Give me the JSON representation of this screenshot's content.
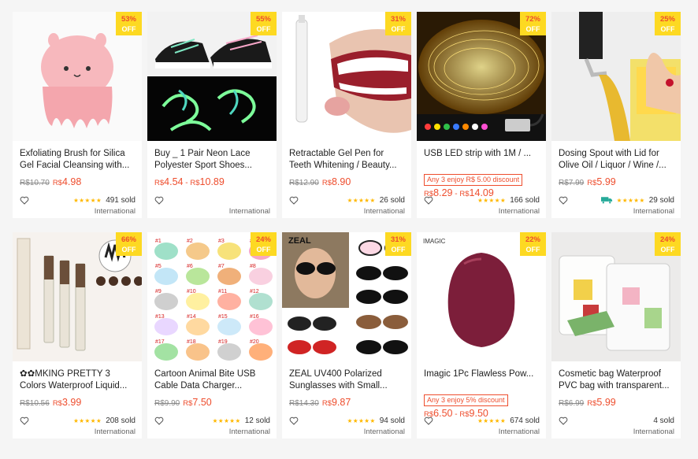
{
  "products": [
    {
      "discount": "53%",
      "off": "OFF",
      "title": "Exfoliating Brush for Silica Gel Facial Cleansing with...",
      "promo": "",
      "orig_price": "R$10.70",
      "price_label": "R$",
      "price": "4.98",
      "price_max_label": "",
      "price_max": "",
      "stars": "★★★★★",
      "sold": "491 sold",
      "ship": "International",
      "icon": "heart-icon"
    },
    {
      "discount": "55%",
      "off": "OFF",
      "title": "Buy _ 1 Pair Neon Lace Polyester Sport Shoes...",
      "promo": "",
      "orig_price": "",
      "price_label": "R$",
      "price": "4.54",
      "price_max_label": "R$",
      "price_max": "10.89",
      "stars": "",
      "sold": "",
      "ship": "International",
      "icon": "heart-icon"
    },
    {
      "discount": "31%",
      "off": "OFF",
      "title": "Retractable Gel Pen for Teeth Whitening / Beauty...",
      "promo": "",
      "orig_price": "R$12.90",
      "price_label": "R$",
      "price": "8.90",
      "price_max_label": "",
      "price_max": "",
      "stars": "★★★★★",
      "sold": "26 sold",
      "ship": "International",
      "icon": "heart-icon"
    },
    {
      "discount": "72%",
      "off": "OFF",
      "title": "USB LED strip with 1M / ...",
      "promo": "Any 3 enjoy R$ 5.00 discount",
      "orig_price": "",
      "price_label": "R$",
      "price": "8.29",
      "price_max_label": "R$",
      "price_max": "14.09",
      "stars": "★★★★★",
      "sold": "166 sold",
      "ship": "International",
      "icon": "heart-icon"
    },
    {
      "discount": "25%",
      "off": "OFF",
      "title": "Dosing Spout with Lid for Olive Oil / Liquor / Wine /...",
      "promo": "",
      "orig_price": "R$7.99",
      "price_label": "R$",
      "price": "5.99",
      "price_max_label": "",
      "price_max": "",
      "stars": "★★★★★",
      "sold": "29 sold",
      "ship": "International",
      "icon": "heart-icon",
      "truck": true
    },
    {
      "discount": "66%",
      "off": "OFF",
      "title": "✿✿MKING PRETTY 3 Colors Waterproof Liquid...",
      "promo": "",
      "orig_price": "R$10.56",
      "price_label": "R$",
      "price": "3.99",
      "price_max_label": "",
      "price_max": "",
      "stars": "★★★★★",
      "sold": "208 sold",
      "ship": "International",
      "icon": "heart-icon"
    },
    {
      "discount": "24%",
      "off": "OFF",
      "title": "Cartoon Animal Bite USB Cable Data Charger...",
      "promo": "",
      "orig_price": "R$9.90",
      "price_label": "R$",
      "price": "7.50",
      "price_max_label": "",
      "price_max": "",
      "stars": "★★★★★",
      "sold": "12 sold",
      "ship": "International",
      "icon": "heart-icon"
    },
    {
      "discount": "31%",
      "off": "OFF",
      "title": "ZEAL UV400 Polarized Sunglasses with Small...",
      "promo": "",
      "orig_price": "R$14.30",
      "price_label": "R$",
      "price": "9.87",
      "price_max_label": "",
      "price_max": "",
      "stars": "★★★★★",
      "sold": "94 sold",
      "ship": "International",
      "icon": "heart-icon"
    },
    {
      "discount": "22%",
      "off": "OFF",
      "title": "Imagic 1Pc Flawless Pow...",
      "promo": "Any 3 enjoy 5% discount",
      "orig_price": "",
      "price_label": "R$",
      "price": "6.50",
      "price_max_label": "R$",
      "price_max": "9.50",
      "stars": "★★★★★",
      "sold": "674 sold",
      "ship": "International",
      "icon": "heart-icon"
    },
    {
      "discount": "24%",
      "off": "OFF",
      "title": "Cosmetic bag Waterproof PVC bag with transparent...",
      "promo": "",
      "orig_price": "R$6.99",
      "price_label": "R$",
      "price": "5.99",
      "price_max_label": "",
      "price_max": "",
      "stars": "",
      "sold": "4 sold",
      "ship": "International",
      "icon": "heart-icon"
    }
  ],
  "image_texts": {
    "zeal_logo": "ZEAL",
    "imagic_logo": "IMAGIC",
    "cable_labels": [
      "#1",
      "#2",
      "#3",
      "#4",
      "#5",
      "#6",
      "#7",
      "#8",
      "#9",
      "#10",
      "#11",
      "#12",
      "#13",
      "#14",
      "#15",
      "#16",
      "#17",
      "#18",
      "#19",
      "#20"
    ]
  },
  "colors": {
    "accent": "#ee4d2d",
    "badge": "#fdd922",
    "stars": "#ffb800",
    "truck": "#26aa99"
  }
}
